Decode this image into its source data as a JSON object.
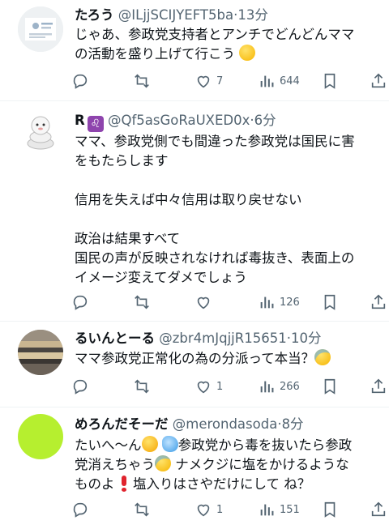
{
  "posts": [
    {
      "name": "たろう",
      "handle": "@ILjjSCIJYEFT5ba",
      "separator": "·",
      "time": "13分",
      "lines": [
        "じゃあ、参政党支持者とアンチでどんどんママ",
        "の活動を盛り上げて行こう"
      ],
      "trailing_emoji": "slightly-smiling-face",
      "counts": {
        "reply": "",
        "repost": "",
        "like": "7",
        "views": "644"
      }
    },
    {
      "name": "R",
      "name_emoji": "♌",
      "handle": "@Qf5asGoRaUXED0x",
      "separator": "·",
      "time": "6分",
      "lines": [
        "ママ、参政党側でも間違った参政党は国民に害",
        "をもたらします",
        "",
        "信用を失えば中々信用は取り戻せない",
        "",
        "政治は結果すべて",
        "国民の声が反映されなければ毒抜き、表面上の",
        "イメージ変えてダメでしょう"
      ],
      "counts": {
        "reply": "",
        "repost": "",
        "like": "",
        "views": "126"
      }
    },
    {
      "name": "るいんとーる",
      "handle": "@zbr4mJqjjR15651",
      "separator": "·",
      "time": "10分",
      "lines": [
        "ママ参政党正常化の為の分派って本当？"
      ],
      "trailing_emoji": "crying-face",
      "counts": {
        "reply": "",
        "repost": "",
        "like": "1",
        "views": "266"
      }
    },
    {
      "name": "めろんだそーだ",
      "handle": "@merondasoda",
      "separator": "·",
      "time": "8分",
      "line1_a": "たいへ～ん",
      "line1_b": "参政党から毒を抜いたら参政",
      "line2_a": "党消えちゃう",
      "line2_b": "ナメクジに塩をかけるような",
      "line3_a": "ものよ",
      "line3_b": "塩入りはさやだけにして ね？",
      "counts": {
        "reply": "",
        "repost": "",
        "like": "1",
        "views": "151"
      }
    }
  ],
  "colors": {
    "text": "#0f1419",
    "secondary": "#536471",
    "separator": "#eff3f4"
  }
}
